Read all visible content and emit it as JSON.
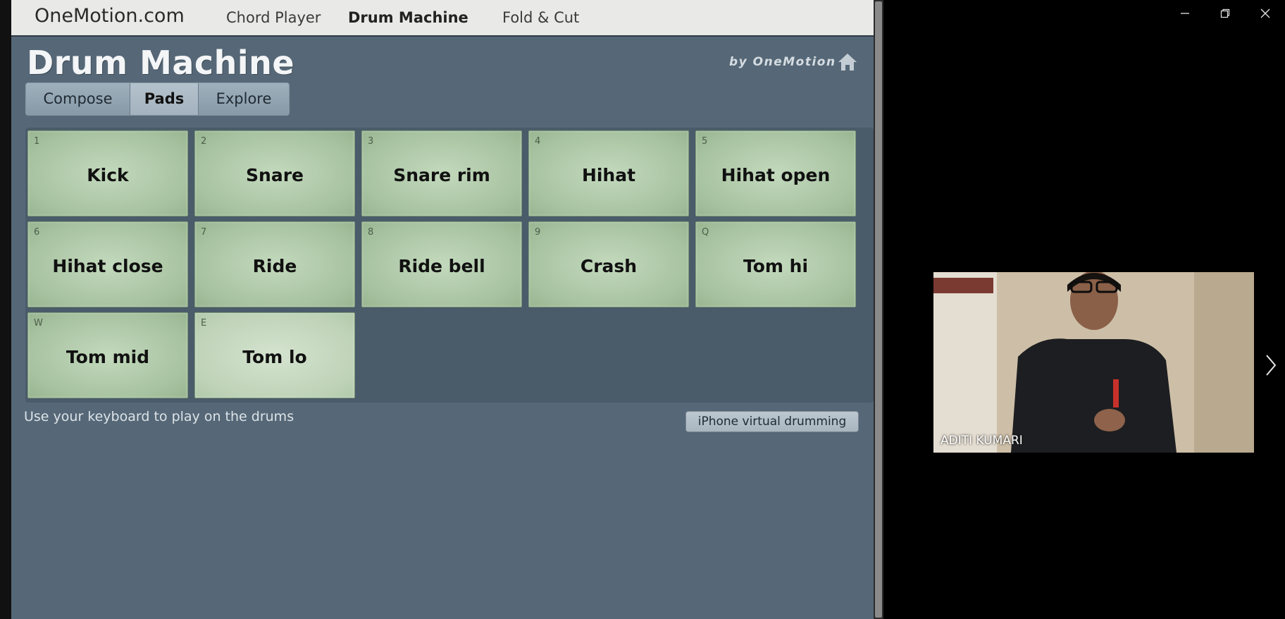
{
  "topnav": {
    "site": "OneMotion.com",
    "links": [
      {
        "label": "Chord Player",
        "active": false
      },
      {
        "label": "Drum Machine",
        "active": true
      },
      {
        "label": "Fold & Cut",
        "active": false
      }
    ]
  },
  "app": {
    "title": "Drum Machine",
    "byline": "by OneMotion",
    "home_icon": "home-icon"
  },
  "tabs": [
    {
      "label": "Compose",
      "active": false
    },
    {
      "label": "Pads",
      "active": true
    },
    {
      "label": "Explore",
      "active": false
    }
  ],
  "pads": [
    {
      "key": "1",
      "name": "Kick"
    },
    {
      "key": "2",
      "name": "Snare"
    },
    {
      "key": "3",
      "name": "Snare rim"
    },
    {
      "key": "4",
      "name": "Hihat"
    },
    {
      "key": "5",
      "name": "Hihat open"
    },
    {
      "key": "6",
      "name": "Hihat close"
    },
    {
      "key": "7",
      "name": "Ride"
    },
    {
      "key": "8",
      "name": "Ride bell"
    },
    {
      "key": "9",
      "name": "Crash"
    },
    {
      "key": "Q",
      "name": "Tom hi"
    },
    {
      "key": "W",
      "name": "Tom mid"
    },
    {
      "key": "E",
      "name": "Tom lo"
    }
  ],
  "hint": "Use your keyboard to play on the drums",
  "iphone_button": "iPhone virtual drumming",
  "window_controls": {
    "minimize": "minimize-icon",
    "restore": "restore-icon",
    "close": "close-icon"
  },
  "video": {
    "participant_name": "ADITI KUMARI"
  },
  "next_arrow": "chevron-right-icon",
  "colors": {
    "app_bg": "#566877",
    "pad_green": "#a8c3a1",
    "topnav_bg": "#e9e9e7"
  }
}
